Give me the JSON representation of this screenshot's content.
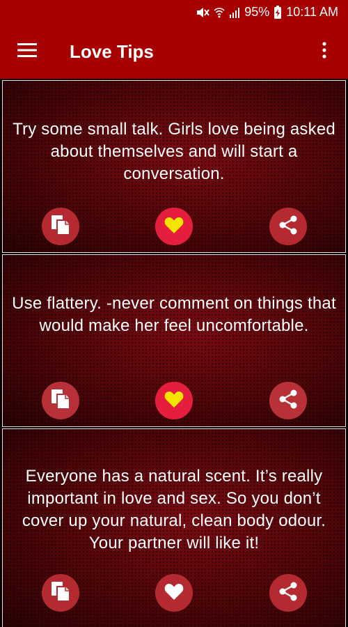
{
  "status_bar": {
    "battery": "95%",
    "time": "10:11 AM",
    "icons": [
      "mute-icon",
      "wifi-icon",
      "signal-icon",
      "battery-charging-icon"
    ]
  },
  "app_bar": {
    "title": "Love Tips",
    "menu_icon": "hamburger-menu-icon",
    "more_icon": "more-vert-icon"
  },
  "colors": {
    "app_bar": "#a70000",
    "card_bg": "#4e0508",
    "copy_button": "#b42a30",
    "favorite_button": "#e61e3d",
    "heart_favorited": "#f5e400",
    "heart_default": "#ffffff"
  },
  "tips": [
    {
      "text": "Try some small talk. Girls love being asked about themselves and will start a conversation.",
      "favorited": true
    },
    {
      "text": "Use flattery. -never comment on things that would make her feel uncomfortable.",
      "favorited": true
    },
    {
      "text": "Everyone has a natural scent. It’s really important in love and sex. So you don’t cover up your natural, clean body odour. Your partner will like it!",
      "favorited": false
    }
  ],
  "actions": {
    "copy_icon": "copy-icon",
    "favorite_icon": "heart-icon",
    "share_icon": "share-icon"
  }
}
